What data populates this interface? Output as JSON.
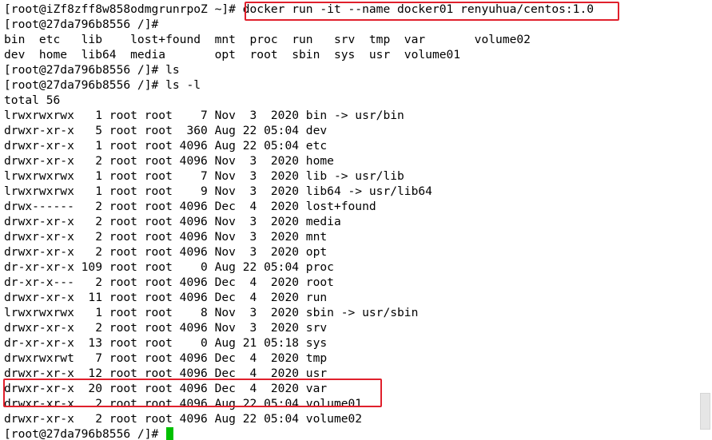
{
  "terminal": {
    "colors": {
      "background": "#ffffff",
      "text": "#000000",
      "cursor": "#00c000",
      "highlight_border": "#e0202c",
      "scrollbar_thumb": "#e6e6e6"
    },
    "lines": [
      {
        "text": "[root@iZf8zff8w858odmgrunrpoZ ~]# docker run -it --name docker01 renyuhua/centos:1.0"
      },
      {
        "text": "[root@27da796b8556 /]#"
      },
      {
        "text": "bin  etc   lib    lost+found  mnt  proc  run   srv  tmp  var       volume02"
      },
      {
        "text": "dev  home  lib64  media       opt  root  sbin  sys  usr  volume01"
      },
      {
        "text": "[root@27da796b8556 /]# ls"
      },
      {
        "text": "[root@27da796b8556 /]# ls -l"
      },
      {
        "text": "total 56"
      },
      {
        "text": "lrwxrwxrwx   1 root root    7 Nov  3  2020 bin -> usr/bin"
      },
      {
        "text": "drwxr-xr-x   5 root root  360 Aug 22 05:04 dev"
      },
      {
        "text": "drwxr-xr-x   1 root root 4096 Aug 22 05:04 etc"
      },
      {
        "text": "drwxr-xr-x   2 root root 4096 Nov  3  2020 home"
      },
      {
        "text": "lrwxrwxrwx   1 root root    7 Nov  3  2020 lib -> usr/lib"
      },
      {
        "text": "lrwxrwxrwx   1 root root    9 Nov  3  2020 lib64 -> usr/lib64"
      },
      {
        "text": "drwx------   2 root root 4096 Dec  4  2020 lost+found"
      },
      {
        "text": "drwxr-xr-x   2 root root 4096 Nov  3  2020 media"
      },
      {
        "text": "drwxr-xr-x   2 root root 4096 Nov  3  2020 mnt"
      },
      {
        "text": "drwxr-xr-x   2 root root 4096 Nov  3  2020 opt"
      },
      {
        "text": "dr-xr-xr-x 109 root root    0 Aug 22 05:04 proc"
      },
      {
        "text": "dr-xr-x---   2 root root 4096 Dec  4  2020 root"
      },
      {
        "text": "drwxr-xr-x  11 root root 4096 Dec  4  2020 run"
      },
      {
        "text": "lrwxrwxrwx   1 root root    8 Nov  3  2020 sbin -> usr/sbin"
      },
      {
        "text": "drwxr-xr-x   2 root root 4096 Nov  3  2020 srv"
      },
      {
        "text": "dr-xr-xr-x  13 root root    0 Aug 21 05:18 sys"
      },
      {
        "text": "drwxrwxrwt   7 root root 4096 Dec  4  2020 tmp"
      },
      {
        "text": "drwxr-xr-x  12 root root 4096 Dec  4  2020 usr"
      },
      {
        "text": "drwxr-xr-x  20 root root 4096 Dec  4  2020 var"
      },
      {
        "text": "drwxr-xr-x   2 root root 4096 Aug 22 05:04 volume01"
      },
      {
        "text": "drwxr-xr-x   2 root root 4096 Aug 22 05:04 volume02"
      },
      {
        "text": "[root@27da796b8556 /]# ",
        "cursor": true
      }
    ]
  }
}
